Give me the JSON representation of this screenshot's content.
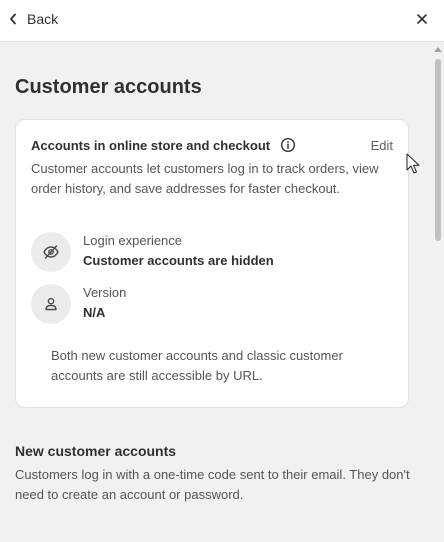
{
  "header": {
    "back_label": "Back",
    "back_icon": "chevron-left-icon",
    "close_icon": "close-icon"
  },
  "page": {
    "title": "Customer accounts"
  },
  "card": {
    "title": "Accounts in online store and checkout",
    "info_icon": "info-icon",
    "edit_label": "Edit",
    "description": "Customer accounts let customers log in to track orders, view order history, and save addresses for faster checkout.",
    "rows": [
      {
        "icon": "eye-off-icon",
        "label": "Login experience",
        "value": "Customer accounts are hidden"
      },
      {
        "icon": "person-icon",
        "label": "Version",
        "value": "N/A"
      }
    ],
    "note": "Both new customer accounts and classic customer accounts are still accessible by URL."
  },
  "new_accounts": {
    "title": "New customer accounts",
    "description": "Customers log in with a one-time code sent to their email. They don't need to create an account or password."
  },
  "colors": {
    "background": "#f1f1f1",
    "card": "#ffffff",
    "text": "#303030",
    "muted_text": "#555555",
    "icon_circle": "#ebebeb"
  }
}
